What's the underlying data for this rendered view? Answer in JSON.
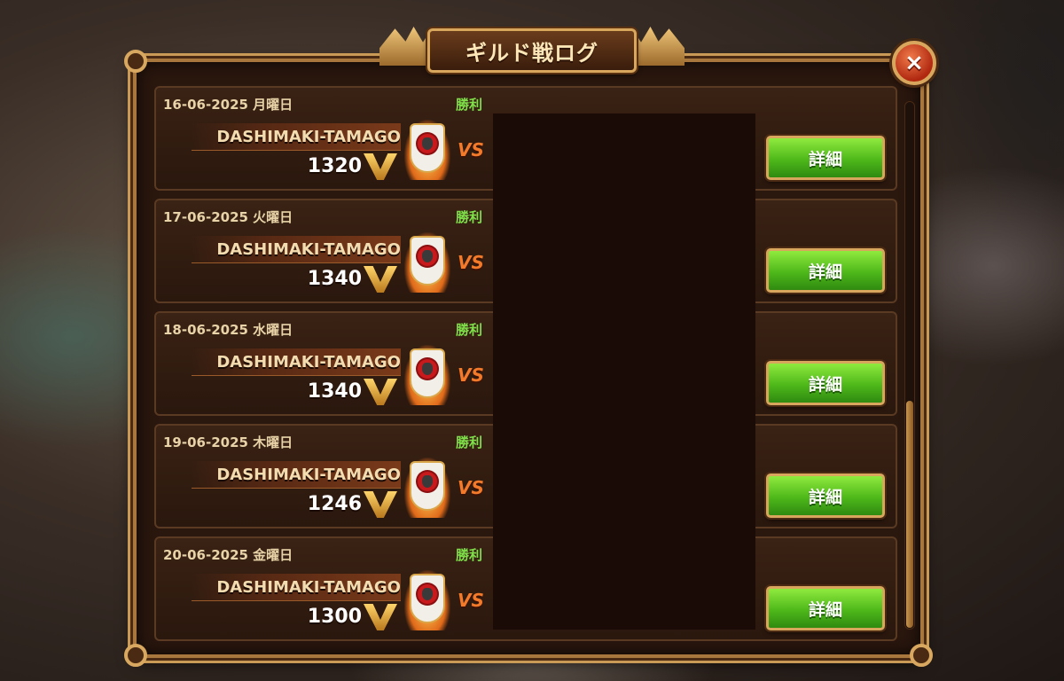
{
  "title": "ギルド戦ログ",
  "close_icon": "×",
  "detail_label": "詳細",
  "vs_label": "VS",
  "entries": [
    {
      "date": "16-06-2025 月曜日",
      "result": "勝利",
      "guild": "DASHIMAKI-TAMAGO",
      "score": "1320"
    },
    {
      "date": "17-06-2025 火曜日",
      "result": "勝利",
      "guild": "DASHIMAKI-TAMAGO",
      "score": "1340"
    },
    {
      "date": "18-06-2025 水曜日",
      "result": "勝利",
      "guild": "DASHIMAKI-TAMAGO",
      "score": "1340"
    },
    {
      "date": "19-06-2025 木曜日",
      "result": "勝利",
      "guild": "DASHIMAKI-TAMAGO",
      "score": "1246"
    },
    {
      "date": "20-06-2025 金曜日",
      "result": "勝利",
      "guild": "DASHIMAKI-TAMAGO",
      "score": "1300"
    }
  ],
  "colors": {
    "win": "#7fe04a",
    "accent_gold": "#d8a65c",
    "button_green": "#4eb81a",
    "close_red": "#b02810"
  },
  "icons": {
    "close": "close-icon",
    "victory_points": "v-points-icon",
    "guild_emblem": "guild-emblem-icon"
  }
}
